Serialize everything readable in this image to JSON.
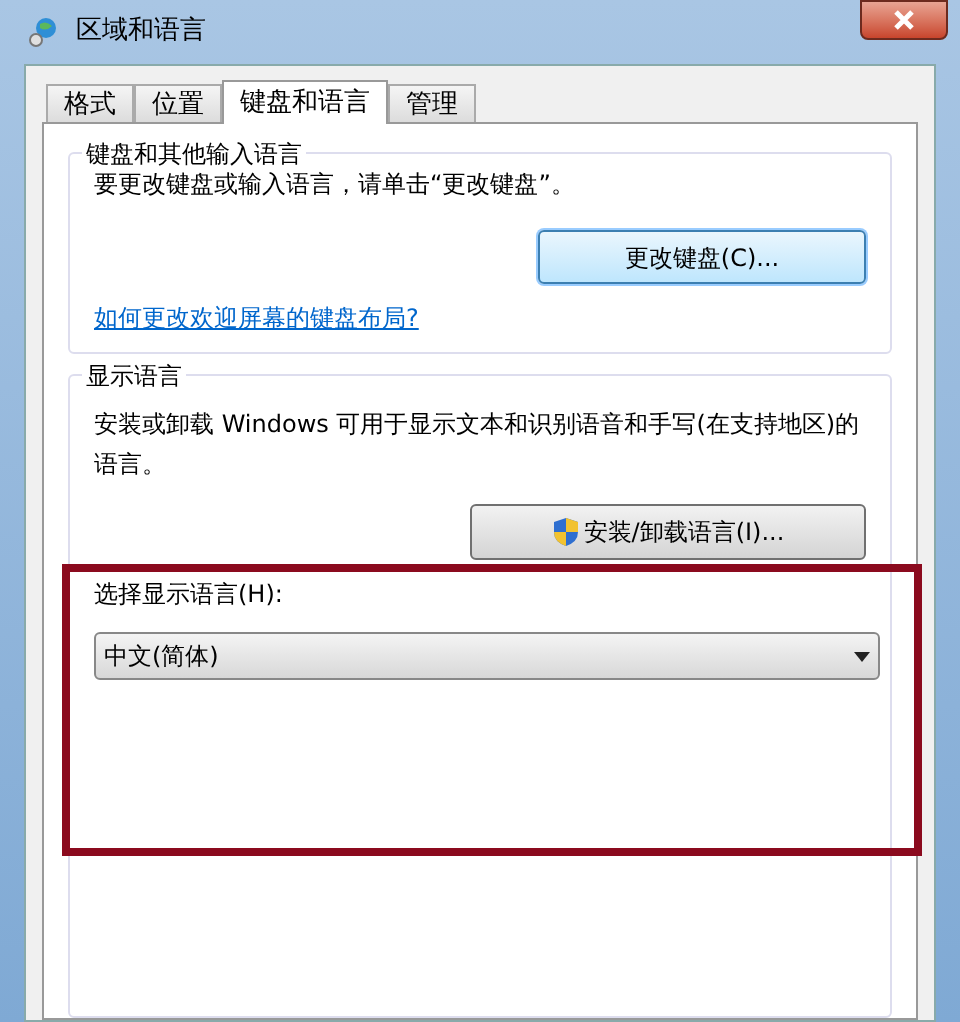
{
  "window": {
    "title": "区域和语言"
  },
  "tabs": [
    {
      "label": "格式",
      "selected": false
    },
    {
      "label": "位置",
      "selected": false
    },
    {
      "label": "键盘和语言",
      "selected": true
    },
    {
      "label": "管理",
      "selected": false
    }
  ],
  "keyboard_group": {
    "title": "键盘和其他输入语言",
    "description": "要更改键盘或输入语言，请单击“更改键盘”。",
    "button": "更改键盘(C)...",
    "link": "如何更改欢迎屏幕的键盘布局?"
  },
  "display_group": {
    "title": "显示语言",
    "description": "安装或卸载 Windows 可用于显示文本和识别语音和手写(在支持地区)的语言。",
    "button": "安装/卸载语言(I)...",
    "select_label": "选择显示语言(H):",
    "select_value": "中文(简体)"
  }
}
